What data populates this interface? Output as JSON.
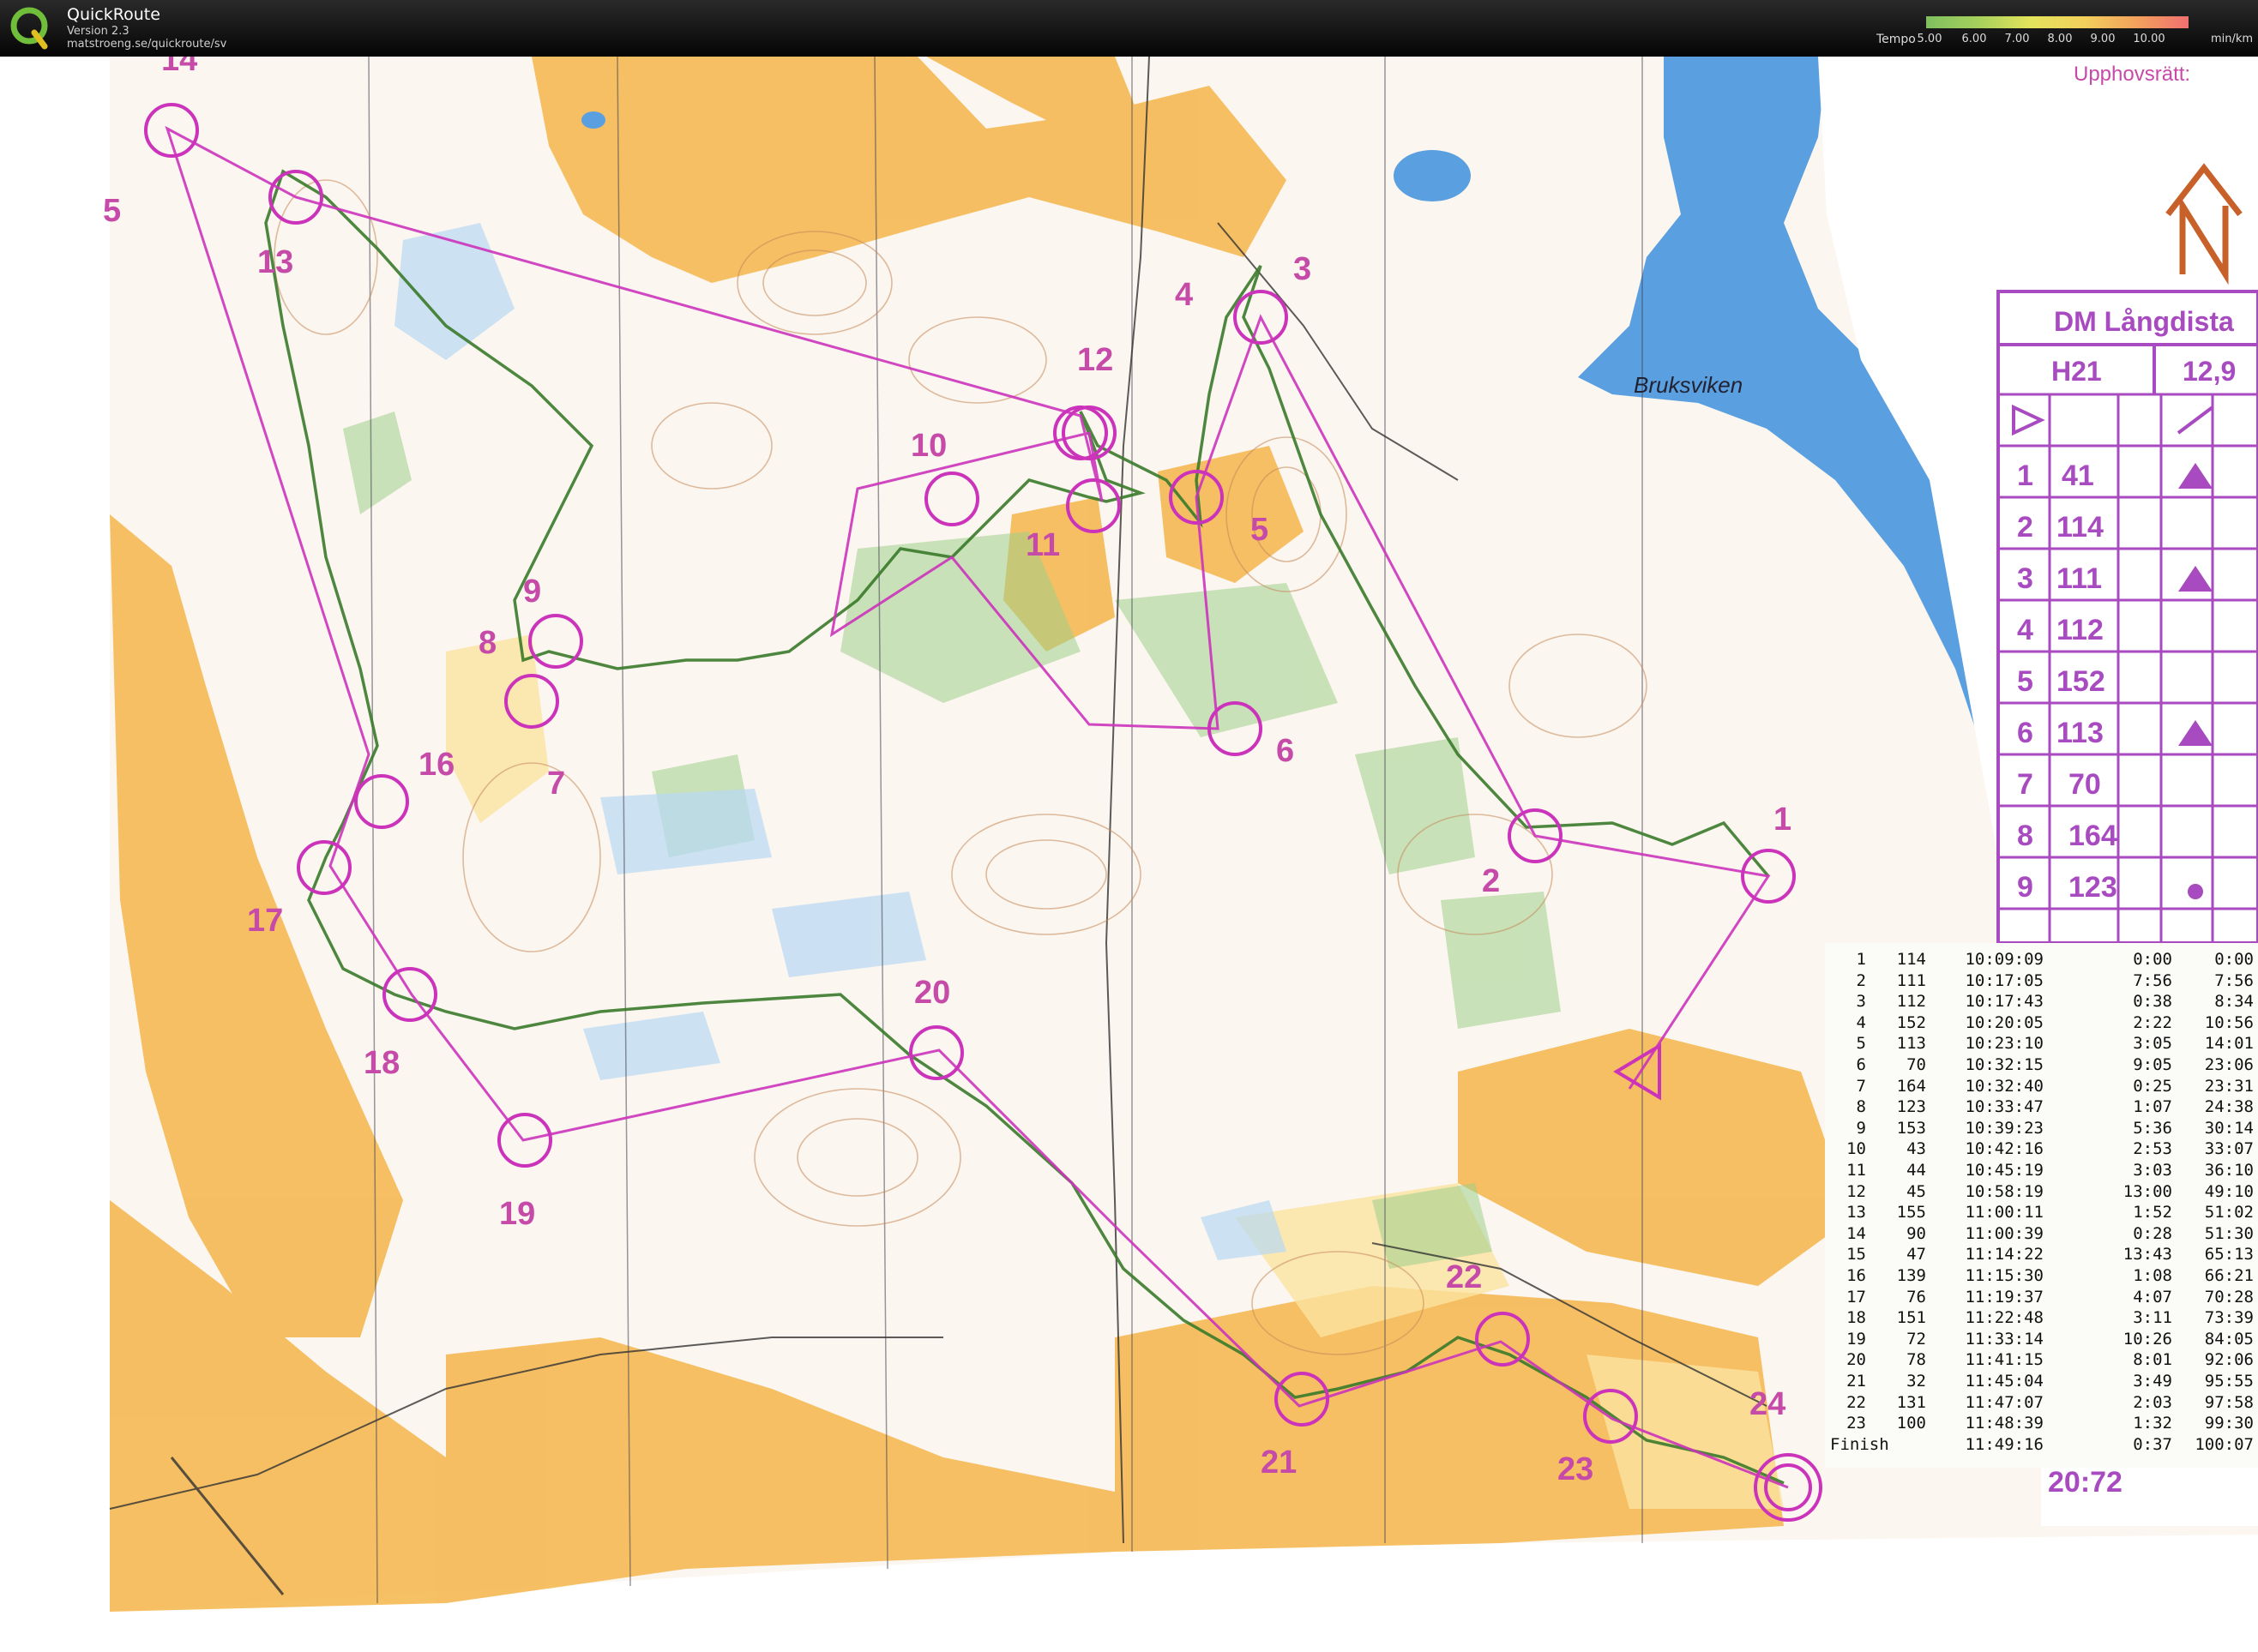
{
  "app": {
    "title": "QuickRoute",
    "version": "Version 2.3",
    "url": "matstroeng.se/quickroute/sv"
  },
  "tempo_legend": {
    "label": "Tempo",
    "ticks": [
      "5.00",
      "6.00",
      "7.00",
      "8.00",
      "9.00",
      "10.00"
    ],
    "unit": "min/km",
    "colors": [
      "#7fbf5f",
      "#a6d05c",
      "#e4e35c",
      "#f2d05c",
      "#f3a25c",
      "#f07070"
    ]
  },
  "map": {
    "place_name": "Bruksviken",
    "copyright_label": "Upphovsrätt:",
    "course_title": "DM Långdista",
    "course_class": "H21",
    "course_length": "12,9",
    "bottom_label": "20:72",
    "north_arrow_icon": "north-arrow-icon",
    "course_color": "#cc33bb",
    "route_color": "#3a7a2a",
    "description_codes": [
      {
        "n": "1",
        "code": "41"
      },
      {
        "n": "2",
        "code": "114"
      },
      {
        "n": "3",
        "code": "111"
      },
      {
        "n": "4",
        "code": "112"
      },
      {
        "n": "5",
        "code": "152"
      },
      {
        "n": "6",
        "code": "113"
      },
      {
        "n": "7",
        "code": "70"
      },
      {
        "n": "8",
        "code": "164"
      },
      {
        "n": "9",
        "code": "123"
      }
    ],
    "control_labels": [
      {
        "label": "1"
      },
      {
        "label": "2"
      },
      {
        "label": "3"
      },
      {
        "label": "4"
      },
      {
        "label": "5"
      },
      {
        "label": "6"
      },
      {
        "label": "7"
      },
      {
        "label": "8"
      },
      {
        "label": "9"
      },
      {
        "label": "10"
      },
      {
        "label": "11"
      },
      {
        "label": "12"
      },
      {
        "label": "13"
      },
      {
        "label": "14"
      },
      {
        "label": "5"
      },
      {
        "label": "16"
      },
      {
        "label": "17"
      },
      {
        "label": "18"
      },
      {
        "label": "19"
      },
      {
        "label": "20"
      },
      {
        "label": "21"
      },
      {
        "label": "22"
      },
      {
        "label": "23"
      },
      {
        "label": "24"
      }
    ]
  },
  "splits": {
    "rows": [
      [
        "1",
        "114",
        "10:09:09",
        "0:00",
        "0:00"
      ],
      [
        "2",
        "111",
        "10:17:05",
        "7:56",
        "7:56"
      ],
      [
        "3",
        "112",
        "10:17:43",
        "0:38",
        "8:34"
      ],
      [
        "4",
        "152",
        "10:20:05",
        "2:22",
        "10:56"
      ],
      [
        "5",
        "113",
        "10:23:10",
        "3:05",
        "14:01"
      ],
      [
        "6",
        "70",
        "10:32:15",
        "9:05",
        "23:06"
      ],
      [
        "7",
        "164",
        "10:32:40",
        "0:25",
        "23:31"
      ],
      [
        "8",
        "123",
        "10:33:47",
        "1:07",
        "24:38"
      ],
      [
        "9",
        "153",
        "10:39:23",
        "5:36",
        "30:14"
      ],
      [
        "10",
        "43",
        "10:42:16",
        "2:53",
        "33:07"
      ],
      [
        "11",
        "44",
        "10:45:19",
        "3:03",
        "36:10"
      ],
      [
        "12",
        "45",
        "10:58:19",
        "13:00",
        "49:10"
      ],
      [
        "13",
        "155",
        "11:00:11",
        "1:52",
        "51:02"
      ],
      [
        "14",
        "90",
        "11:00:39",
        "0:28",
        "51:30"
      ],
      [
        "15",
        "47",
        "11:14:22",
        "13:43",
        "65:13"
      ],
      [
        "16",
        "139",
        "11:15:30",
        "1:08",
        "66:21"
      ],
      [
        "17",
        "76",
        "11:19:37",
        "4:07",
        "70:28"
      ],
      [
        "18",
        "151",
        "11:22:48",
        "3:11",
        "73:39"
      ],
      [
        "19",
        "72",
        "11:33:14",
        "10:26",
        "84:05"
      ],
      [
        "20",
        "78",
        "11:41:15",
        "8:01",
        "92:06"
      ],
      [
        "21",
        "32",
        "11:45:04",
        "3:49",
        "95:55"
      ],
      [
        "22",
        "131",
        "11:47:07",
        "2:03",
        "97:58"
      ],
      [
        "23",
        "100",
        "11:48:39",
        "1:32",
        "99:30"
      ],
      [
        "Finish",
        "",
        "11:49:16",
        "0:37",
        "100:07"
      ]
    ]
  }
}
